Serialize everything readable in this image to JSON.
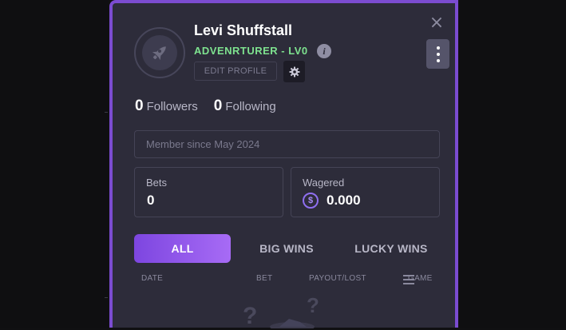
{
  "profile": {
    "username": "Levi Shuffstall",
    "level": "ADVENRTURER - LV0",
    "edit_label": "EDIT PROFILE",
    "member_since": "Member since May 2024"
  },
  "social": {
    "followers_count": "0",
    "followers_label": "Followers",
    "following_count": "0",
    "following_label": "Following"
  },
  "stats": {
    "bets_label": "Bets",
    "bets_value": "0",
    "wagered_label": "Wagered",
    "wagered_value": "0.000",
    "currency_symbol": "$"
  },
  "tabs": [
    {
      "label": "ALL",
      "active": true
    },
    {
      "label": "BIG WINS",
      "active": false
    },
    {
      "label": "LUCKY WINS",
      "active": false
    }
  ],
  "table": {
    "columns": [
      "DATE",
      "BET",
      "PAYOUT/LOST",
      "GAME"
    ]
  },
  "empty_state": {
    "glyph": "?"
  },
  "icons": {
    "close": "close-icon",
    "info": "info-icon",
    "settings": "gear-icon",
    "more": "more-vertical-icon",
    "avatar": "rocket-icon",
    "currency": "coin-icon",
    "filter": "filter-icon"
  },
  "colors": {
    "accent": "#7b4cd0",
    "level_green": "#7ee28f",
    "panel_bg": "#2d2c3a",
    "tab_active_start": "#7d46e0",
    "tab_active_end": "#a76bf5"
  }
}
